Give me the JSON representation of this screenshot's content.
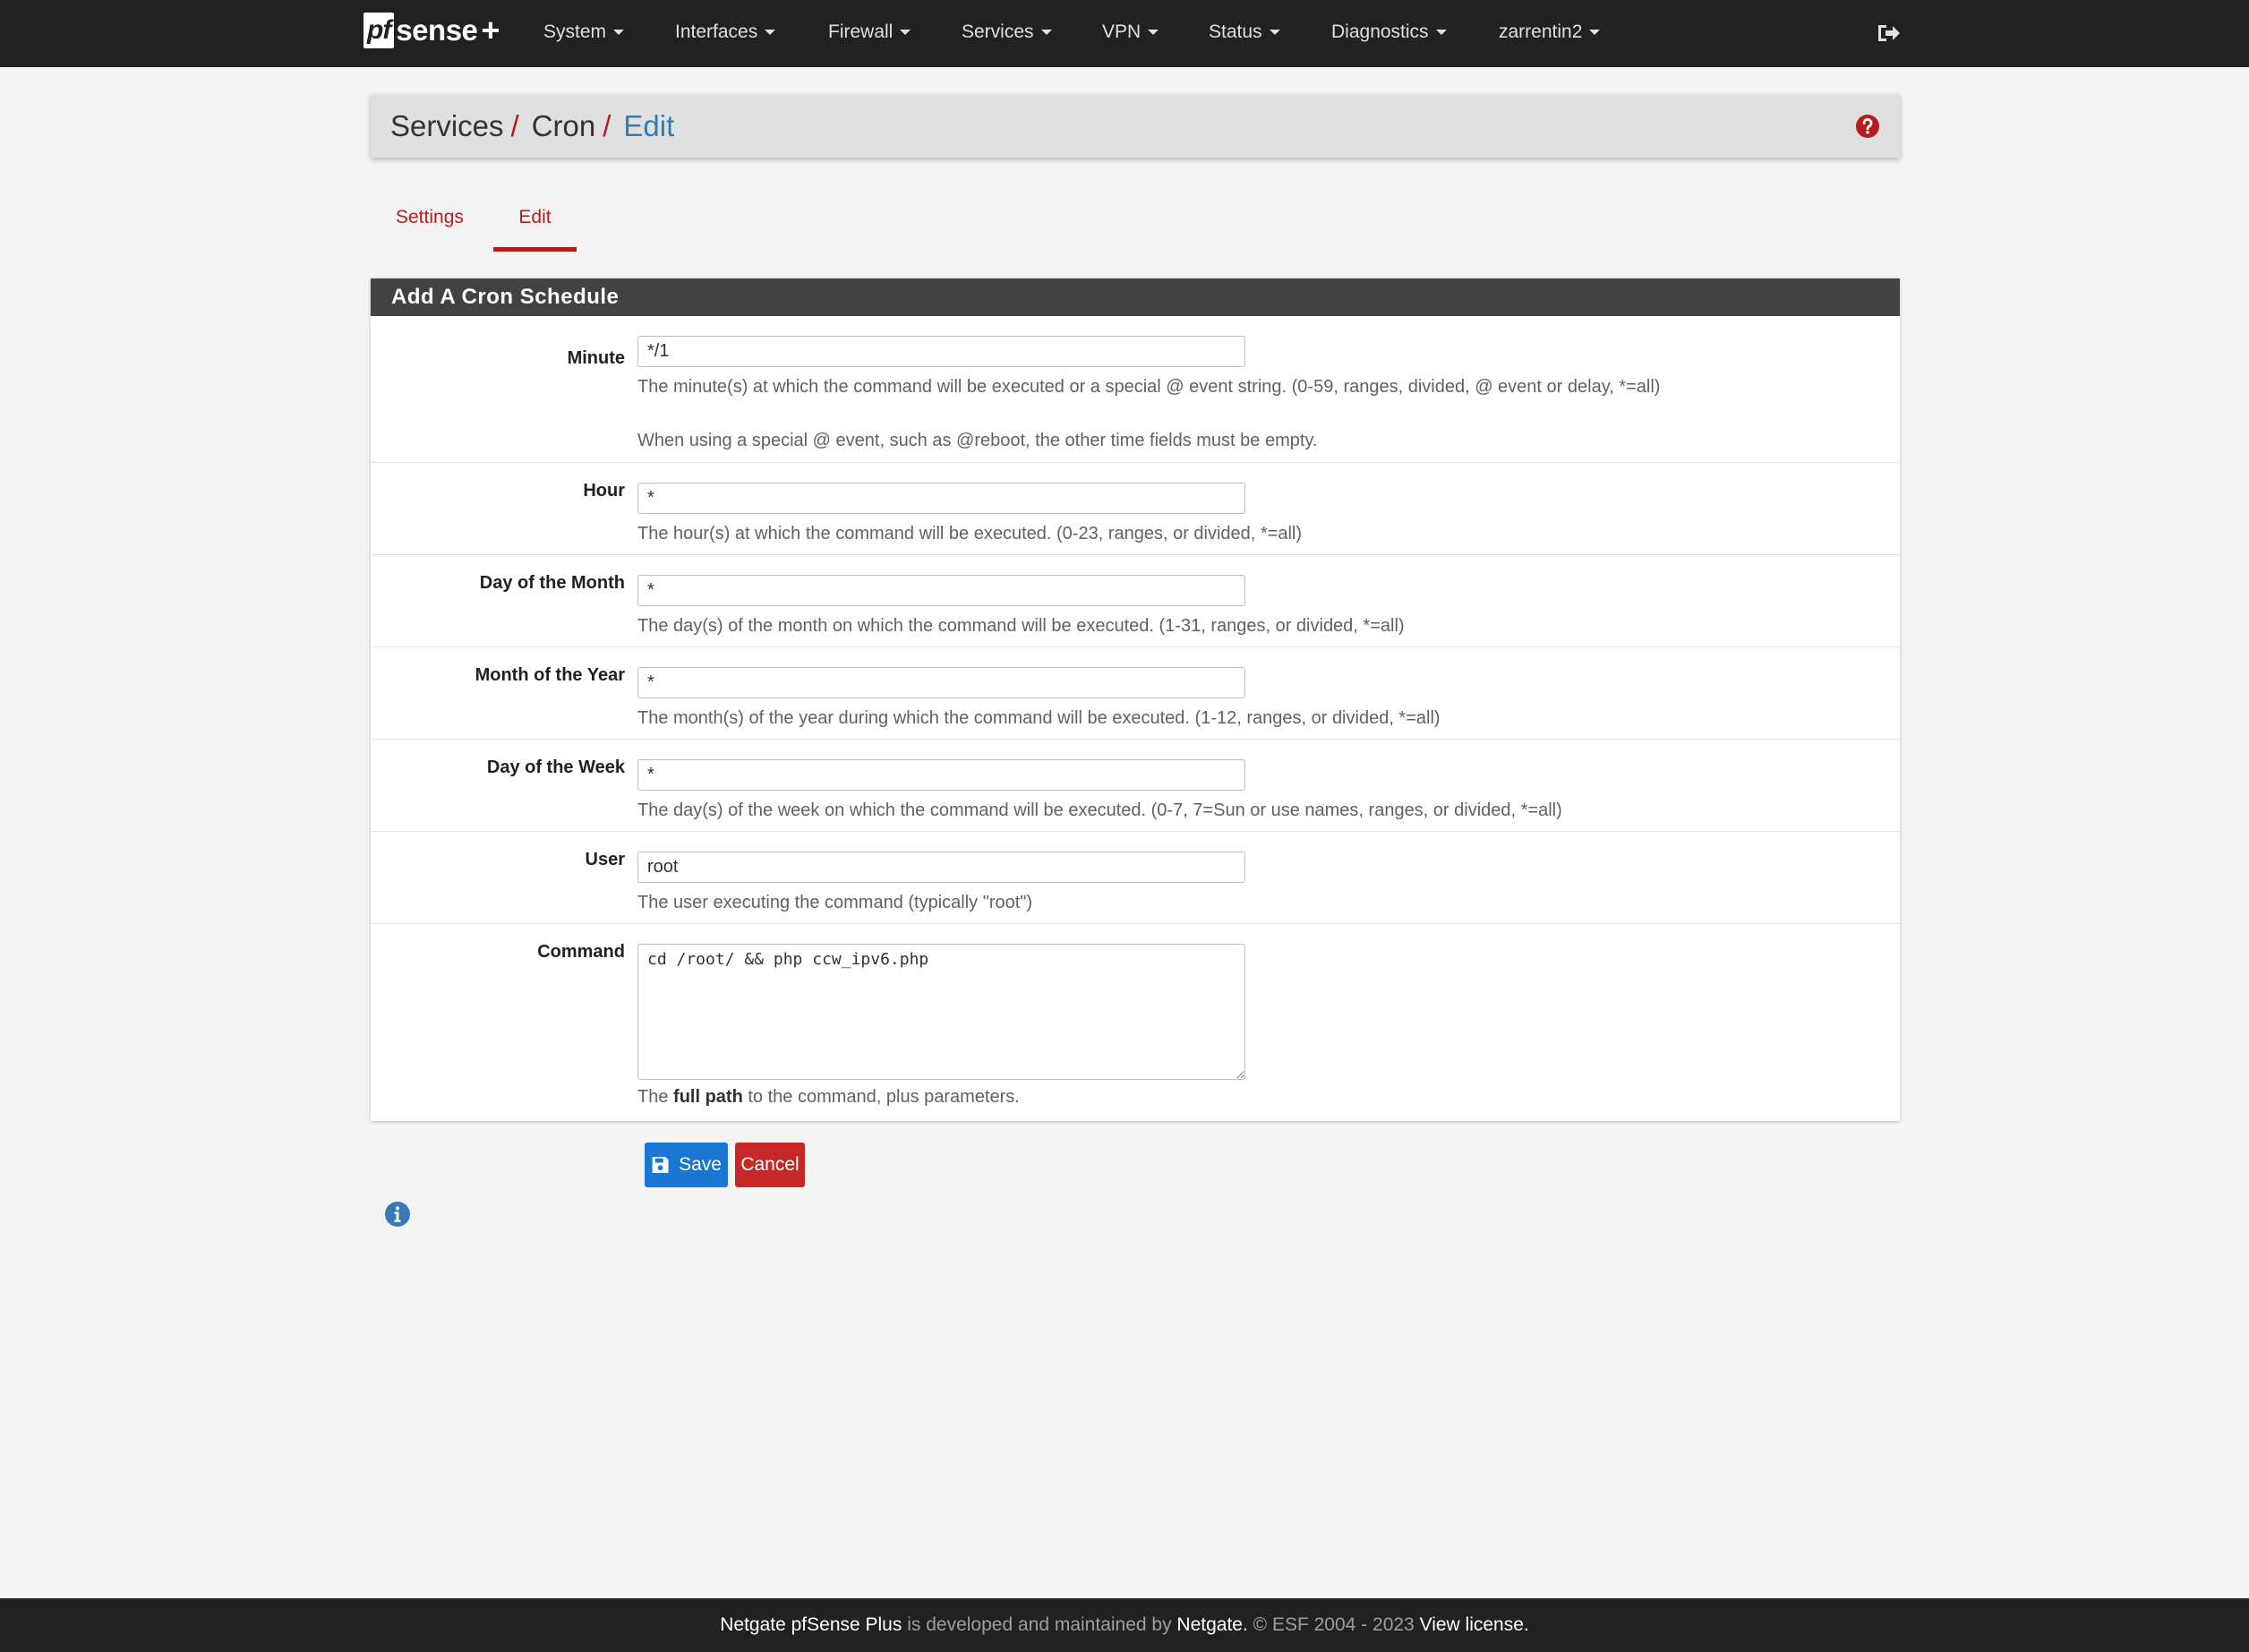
{
  "brand": {
    "logo_pf": "pf",
    "logo_sense": "sense",
    "logo_plus": "+"
  },
  "nav": {
    "items": [
      {
        "label": "System"
      },
      {
        "label": "Interfaces"
      },
      {
        "label": "Firewall"
      },
      {
        "label": "Services"
      },
      {
        "label": "VPN"
      },
      {
        "label": "Status"
      },
      {
        "label": "Diagnostics"
      },
      {
        "label": "zarrentin2"
      }
    ],
    "logout_icon": "sign-out-icon"
  },
  "breadcrumb": {
    "items": [
      "Services",
      "Cron",
      "Edit"
    ],
    "separator": "/",
    "help_icon": "question-circle-icon"
  },
  "tabs": [
    {
      "label": "Settings",
      "active": false
    },
    {
      "label": "Edit",
      "active": true
    }
  ],
  "form": {
    "heading": "Add A Cron Schedule",
    "minute": {
      "label": "Minute",
      "value": "*/1",
      "help1": "The minute(s) at which the command will be executed or a special @ event string. (0-59, ranges, divided, @ event or delay, *=all)",
      "help2": "When using a special @ event, such as @reboot, the other time fields must be empty."
    },
    "hour": {
      "label": "Hour",
      "value": "*",
      "help": "The hour(s) at which the command will be executed. (0-23, ranges, or divided, *=all)"
    },
    "mday": {
      "label": "Day of the Month",
      "value": "*",
      "help": "The day(s) of the month on which the command will be executed. (1-31, ranges, or divided, *=all)"
    },
    "month": {
      "label": "Month of the Year",
      "value": "*",
      "help": "The month(s) of the year during which the command will be executed. (1-12, ranges, or divided, *=all)"
    },
    "wday": {
      "label": "Day of the Week",
      "value": "*",
      "help": "The day(s) of the week on which the command will be executed. (0-7, 7=Sun or use names, ranges, or divided, *=all)"
    },
    "user": {
      "label": "User",
      "value": "root",
      "help": "The user executing the command (typically \"root\")"
    },
    "command": {
      "label": "Command",
      "value": "cd /root/ && php ccw_ipv6.php",
      "help_prefix": "The ",
      "help_bold": "full path",
      "help_suffix": " to the command, plus parameters."
    }
  },
  "buttons": {
    "save_label": "Save",
    "save_icon": "save-icon",
    "cancel_label": "Cancel"
  },
  "info_icon": "info-circle-icon",
  "footer": {
    "product": "Netgate pfSense Plus",
    "middle": " is developed and maintained by ",
    "company": "Netgate.",
    "copyright": " © ESF 2004 - 2023 ",
    "license": "View license."
  },
  "colors": {
    "navbar_bg": "#212121",
    "accent_red": "#b71c1c",
    "link_blue": "#337ab7",
    "save_blue": "#1976d2",
    "cancel_red": "#c62828",
    "panel_heading_bg": "#424242",
    "page_bg": "#f4f4f4"
  }
}
